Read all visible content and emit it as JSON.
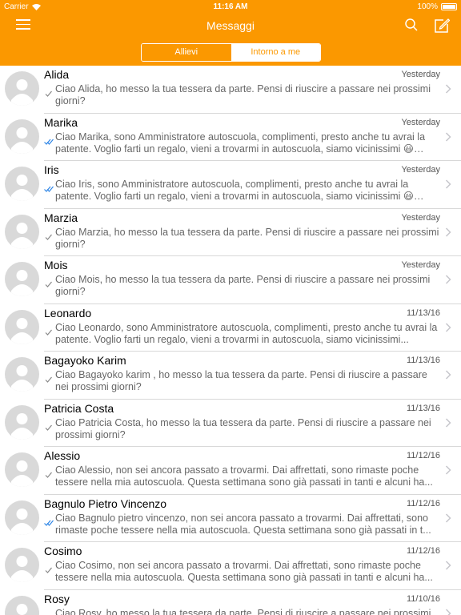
{
  "status": {
    "carrier": "Carrier",
    "time": "11:16 AM",
    "battery": "100%"
  },
  "nav": {
    "title": "Messaggi"
  },
  "segments": [
    {
      "label": "Allievi",
      "active": true
    },
    {
      "label": "Intorno a me",
      "active": false
    }
  ],
  "messages": [
    {
      "name": "Alida",
      "date": "Yesterday",
      "preview": "Ciao Alida, ho messo la tua tessera da parte. Pensi di riuscire a passare nei prossimi giorni?",
      "read": false
    },
    {
      "name": "Marika",
      "date": "Yesterday",
      "preview": "Ciao Marika, sono Amministratore autoscuola, complimenti, presto anche tu avrai la patente. Voglio farti un regalo, vieni a trovarmi in autoscuola, siamo vicinissimi 😃…",
      "read": true
    },
    {
      "name": "Iris",
      "date": "Yesterday",
      "preview": "Ciao Iris, sono Amministratore autoscuola, complimenti, presto anche tu avrai la patente. Voglio farti un regalo, vieni a trovarmi in autoscuola, siamo vicinissimi 😃…",
      "read": true
    },
    {
      "name": "Marzia",
      "date": "Yesterday",
      "preview": "Ciao Marzia, ho messo la tua tessera da parte. Pensi di riuscire a passare nei prossimi giorni?",
      "read": false
    },
    {
      "name": "Mois",
      "date": "Yesterday",
      "preview": "Ciao Mois, ho messo la tua tessera da parte. Pensi di riuscire a passare nei prossimi giorni?",
      "read": false
    },
    {
      "name": "Leonardo",
      "date": "11/13/16",
      "preview": "Ciao Leonardo, sono Amministratore autoscuola, complimenti, presto anche tu avrai la patente. Voglio farti un regalo, vieni a trovarmi in autoscuola, siamo vicinissimi...",
      "read": false
    },
    {
      "name": "Bagayoko Karim",
      "date": "11/13/16",
      "preview": "Ciao Bagayoko karim , ho messo la tua tessera da parte. Pensi di riuscire a passare nei prossimi giorni?",
      "read": false
    },
    {
      "name": "Patricia Costa",
      "date": "11/13/16",
      "preview": "Ciao Patricia Costa, ho messo la tua tessera da parte. Pensi di riuscire a passare nei prossimi giorni?",
      "read": false
    },
    {
      "name": "Alessio",
      "date": "11/12/16",
      "preview": "Ciao Alessio, non sei ancora passato a trovarmi. Dai affrettati, sono rimaste poche tessere nella mia autoscuola. Questa settimana sono già passati in tanti e alcuni ha...",
      "read": false
    },
    {
      "name": "Bagnulo Pietro Vincenzo",
      "date": "11/12/16",
      "preview": "Ciao Bagnulo pietro vincenzo, non sei ancora passato a trovarmi. Dai affrettati, sono rimaste poche tessere nella mia autoscuola. Questa settimana sono già passati in t...",
      "read": true
    },
    {
      "name": "Cosimo",
      "date": "11/12/16",
      "preview": "Ciao Cosimo, non sei ancora passato a trovarmi. Dai affrettati, sono rimaste poche tessere nella mia autoscuola. Questa settimana sono già passati in tanti e alcuni ha...",
      "read": false
    },
    {
      "name": "Rosy",
      "date": "11/10/16",
      "preview": "Ciao Rosy, ho messo la tua tessera da parte. Pensi di riuscire a passare nei prossimi giorni?",
      "read": false
    }
  ],
  "colors": {
    "accent": "#fb9800",
    "read_check": "#2f86e6",
    "sent_check": "#888888"
  }
}
